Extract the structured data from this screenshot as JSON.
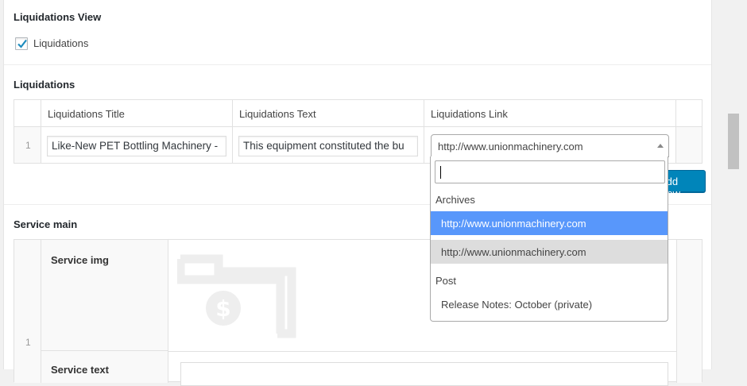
{
  "liquidations_view": {
    "label": "Liquidations View",
    "checkbox_label": "Liquidations",
    "checked": true
  },
  "liquidations": {
    "label": "Liquidations",
    "columns": [
      "Liquidations Title",
      "Liquidations Text",
      "Liquidations Link"
    ],
    "rows": [
      {
        "number": "1",
        "title": "Like-New PET Bottling Machinery -",
        "text": "This equipment constituted the bu",
        "link": "http://www.unionmachinery.com"
      }
    ],
    "add_row_label": "Add Row"
  },
  "link_dropdown": {
    "search_value": "",
    "groups": [
      {
        "label": "Archives",
        "options": [
          {
            "label": "http://www.unionmachinery.com",
            "state": "highlighted"
          },
          {
            "label": "http://www.unionmachinery.com",
            "state": "selected"
          }
        ]
      },
      {
        "label": "Post",
        "options": [
          {
            "label": "Release Notes: October (private)",
            "state": "normal"
          }
        ]
      }
    ]
  },
  "service_main": {
    "label": "Service main",
    "row_number": "1",
    "img_label": "Service img",
    "text_label": "Service text"
  },
  "colors": {
    "accent": "#0085ba",
    "highlight": "#5897fb",
    "checkmark": "#1e8cbe"
  }
}
